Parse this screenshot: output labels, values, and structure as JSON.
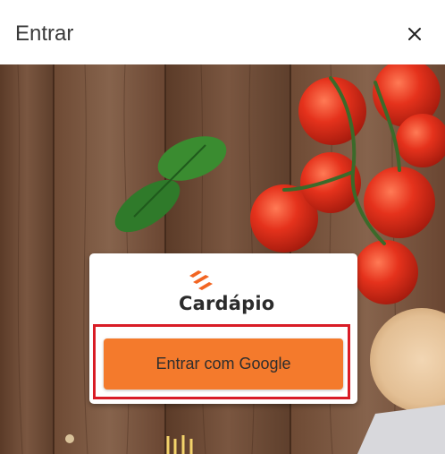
{
  "dialog": {
    "title": "Entrar",
    "close_icon": "close-icon"
  },
  "brand": {
    "name": "Cardápio",
    "logo_color": "#f26522"
  },
  "login": {
    "google_button_label": "Entrar com Google",
    "button_color": "#f47a2c",
    "highlight_color": "#d91c26"
  }
}
